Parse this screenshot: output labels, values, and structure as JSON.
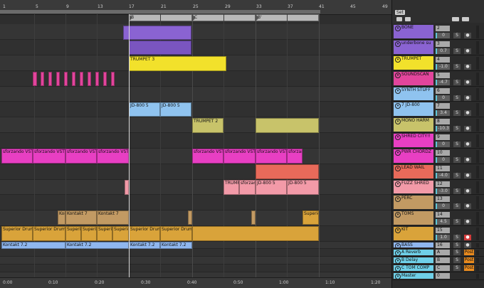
{
  "ruler": {
    "bars": [
      "1",
      "5",
      "9",
      "13",
      "17",
      "21",
      "25",
      "29",
      "33",
      "37",
      "41",
      "45",
      "49"
    ],
    "locators": [
      "B",
      "C",
      "B'"
    ]
  },
  "timeline": {
    "labels": [
      "0:00",
      "0:10",
      "0:20",
      "0:30",
      "0:40",
      "0:50",
      "1:00",
      "1:10",
      "1:20"
    ]
  },
  "clips": {
    "bone_a": "",
    "trumpet3": "TRUMPET 3",
    "jd800_a": "JD-800 5",
    "jd800_b": "JD-800 5",
    "trumpet2": "TRUMPET 2",
    "sfor_1": "sforzando VST",
    "sfor_2": "sforzando VST",
    "sfor_3": "sforzando VST",
    "sfor_4": "sforzando VST",
    "sfor_5": "sforzando VST",
    "sfor_6": "sforzando VST",
    "sfor_7": "sforzando VST",
    "sfor_8": "sforzando VST",
    "sfor_9": "sforzando VST",
    "trump_f": "TRUMF",
    "sfor_10": "sforzando VST",
    "jd800_c": "JD-800 5",
    "jd800_d": "JD-800 5",
    "kon_1": "Kor",
    "kon_2": "Kontakt 7",
    "kon_3": "Kontakt 7",
    "kon_4": "Superior Drums",
    "sup_1": "Superior Drums",
    "sup_2": "Superior Drums",
    "sup_3": "Superior Drums",
    "sup_4": "Superior Drums",
    "sup_5": "Superior Drums",
    "sup_6": "Superior Drums",
    "sup_7": "Superior Drums",
    "sup_8": "Superior Drums",
    "kon_b1": "Kontakt 7.2",
    "kon_b2": "Kontakt 7.2",
    "kon_b3": "Kontakt 7.2",
    "kon_b4": "Kontakt 7.2"
  },
  "mixer": {
    "header": "Set",
    "tracks": [
      {
        "name": "BONE",
        "color": "#8a63d2",
        "num": "2",
        "vol": "0",
        "s": "S",
        "r": "●"
      },
      {
        "name": "underbone su",
        "color": "#8a63d2",
        "num": "3",
        "vol": "0.7",
        "s": "S",
        "r": "●"
      },
      {
        "name": "TRUMPET",
        "color": "#f2e12b",
        "num": "4",
        "vol": "-1.0",
        "s": "S",
        "r": "●"
      },
      {
        "name": "SOUNDSCAN",
        "color": "#e2459c",
        "num": "5",
        "vol": "-4.7",
        "s": "S",
        "r": "●"
      },
      {
        "name": "SYNTH STUFF",
        "color": "#8fc3ef",
        "num": "6",
        "vol": "0",
        "s": "S",
        "r": "●"
      },
      {
        "name": "7 JD-800",
        "color": "#8fc3ef",
        "num": "7",
        "vol": "3.4",
        "s": "S",
        "r": "●"
      },
      {
        "name": "MONO HARM",
        "color": "#c8c36a",
        "num": "8",
        "vol": "-10.3",
        "s": "S",
        "r": "●"
      },
      {
        "name": "SHRED CITY!!",
        "color": "#e83fc3",
        "num": "9",
        "vol": "0",
        "s": "S",
        "r": "●"
      },
      {
        "name": "PWR CHORDZ",
        "color": "#e83fc3",
        "num": "10",
        "vol": "0",
        "s": "S",
        "r": "●"
      },
      {
        "name": "LEAD WAIL",
        "color": "#e86a5a",
        "num": "11",
        "vol": "-4.0",
        "s": "S",
        "r": "●"
      },
      {
        "name": "FUZZ SHRED",
        "color": "#f29aa8",
        "num": "12",
        "vol": "-3.0",
        "s": "S",
        "r": "●"
      },
      {
        "name": "PERC",
        "color": "#c29a63",
        "num": "13",
        "vol": "0",
        "s": "S",
        "r": "●"
      },
      {
        "name": "TOMS",
        "color": "#c29a63",
        "num": "14",
        "vol": "4.5",
        "s": "S",
        "r": "●"
      },
      {
        "name": "KIT",
        "color": "#d9a33a",
        "num": "15",
        "vol": "1.0",
        "s": "S",
        "r": "●"
      },
      {
        "name": "BASS",
        "color": "#8fb7ef",
        "num": "16",
        "vol": "0",
        "s": "S",
        "r": "●"
      },
      {
        "name": "A Reverb",
        "color": "#6fd0e8",
        "num": "A",
        "vol": "",
        "s": "S",
        "r": "Post"
      },
      {
        "name": "B Delay",
        "color": "#6fd0e8",
        "num": "B",
        "vol": "",
        "s": "S",
        "r": "Post"
      },
      {
        "name": "C TOM COMP",
        "color": "#6fd0e8",
        "num": "C",
        "vol": "",
        "s": "S",
        "r": "Post"
      },
      {
        "name": "Master",
        "color": "#6fd0e8",
        "num": "0",
        "vol": "",
        "s": "",
        "r": ""
      }
    ]
  },
  "colors": {
    "accent": "#5dc7d8",
    "arm": "#d23b3b"
  }
}
